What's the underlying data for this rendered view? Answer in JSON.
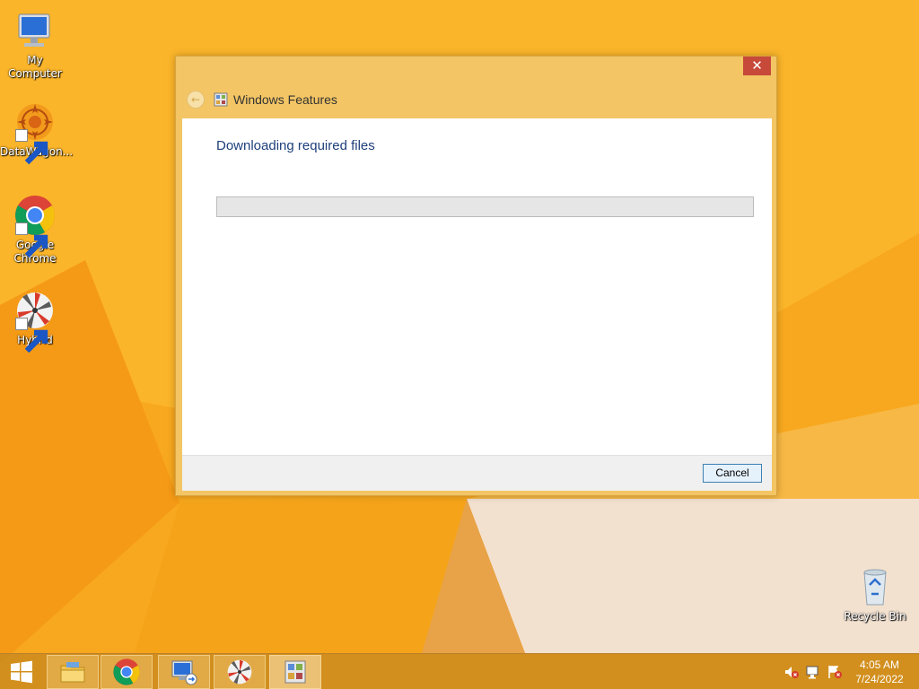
{
  "desktop": {
    "icons": [
      {
        "label": "My Computer",
        "icon": "monitor-icon"
      },
      {
        "label": "DataWagon...",
        "icon": "datawagon-icon"
      },
      {
        "label": "Google Chrome",
        "icon": "chrome-icon"
      },
      {
        "label": "Hybrid",
        "icon": "hybrid-icon"
      },
      {
        "label": "Recycle Bin",
        "icon": "recycle-bin-icon"
      }
    ]
  },
  "dialog": {
    "close_label": "✕",
    "title": "Windows Features",
    "heading": "Downloading required files",
    "progress": 0,
    "cancel_label": "Cancel"
  },
  "taskbar": {
    "items": [
      {
        "icon": "windows-start-icon"
      },
      {
        "icon": "file-explorer-icon"
      },
      {
        "icon": "chrome-icon"
      },
      {
        "icon": "remote-desktop-icon"
      },
      {
        "icon": "hybrid-icon"
      },
      {
        "icon": "windows-features-icon"
      }
    ],
    "tray": [
      "volume-muted-icon",
      "network-icon",
      "action-center-icon"
    ],
    "time": "4:05 AM",
    "date": "7/24/2022"
  },
  "colors": {
    "wallpaper": "#f7a51e",
    "dialog_frame": "#f3c564",
    "close_button": "#c7493a",
    "heading_text": "#1e3f7a",
    "taskbar": "#cc8b1e"
  }
}
